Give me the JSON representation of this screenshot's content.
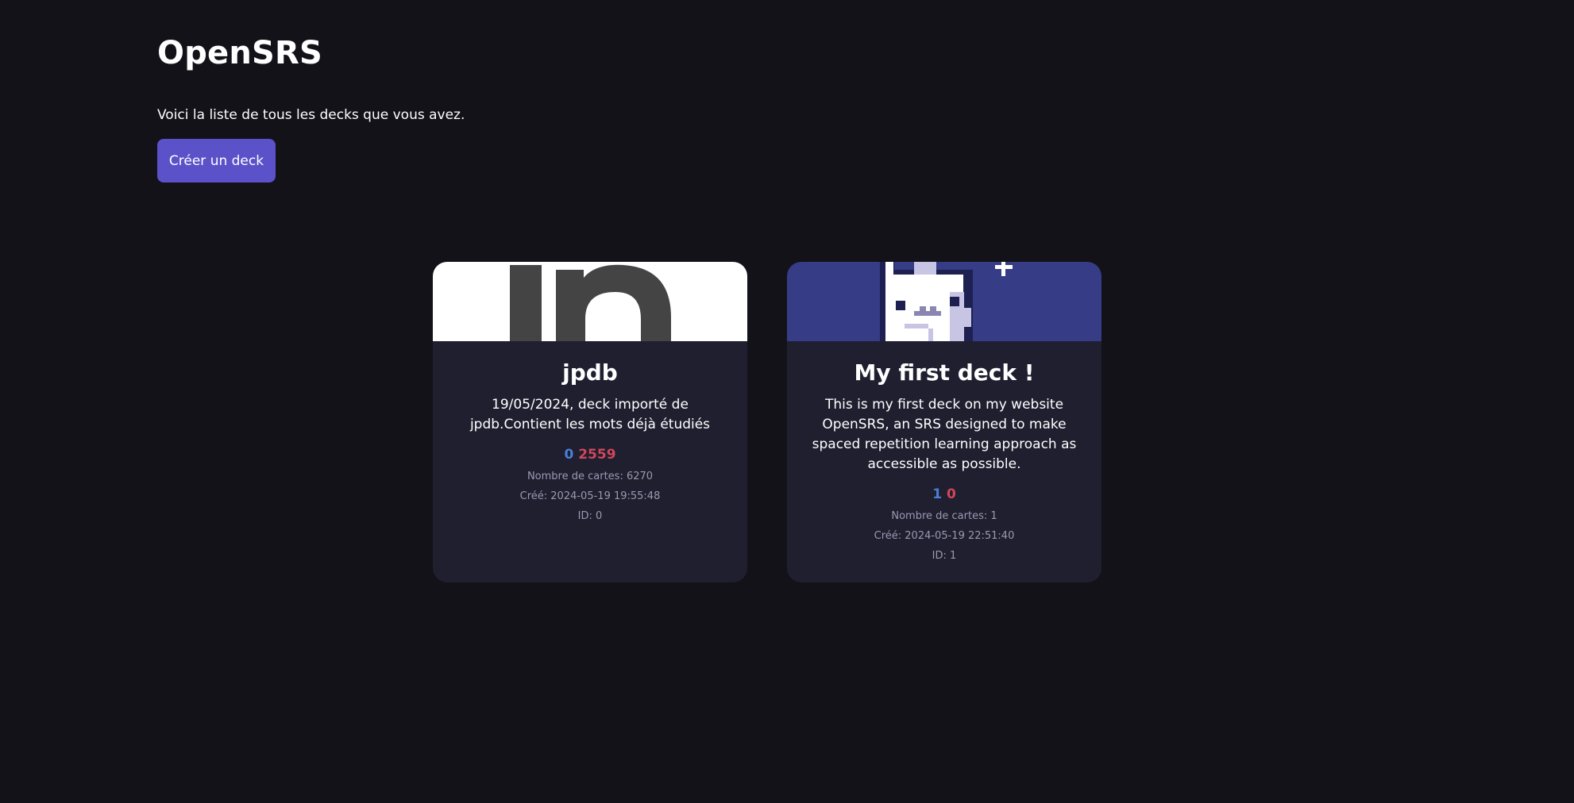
{
  "app": {
    "title": "OpenSRS",
    "intro": "Voici la liste de tous les decks que vous avez.",
    "create_button_label": "Créer un deck"
  },
  "decks": [
    {
      "name": "jpdb",
      "description": "19/05/2024, deck importé de jpdb.Contient les mots déjà étudiés",
      "new_count": "0",
      "due_count": "2559",
      "card_count": "Nombre de cartes: 6270",
      "created": "Créé: 2024-05-19 19:55:48",
      "id": "ID: 0",
      "banner_color": "#ffffff"
    },
    {
      "name": "My first deck !",
      "description": "This is my first deck on my website OpenSRS, an SRS designed to make spaced repetition learning approach as accessible as possible.",
      "new_count": "1",
      "due_count": "0",
      "card_count": "Nombre de cartes: 1",
      "created": "Créé: 2024-05-19 22:51:40",
      "id": "ID: 1",
      "banner_color": "#363c85"
    }
  ],
  "colors": {
    "background": "#121218",
    "card": "#1f1f30",
    "accent": "#5b51c9",
    "new_count": "#4a7fd6",
    "due_count": "#d0475a"
  }
}
